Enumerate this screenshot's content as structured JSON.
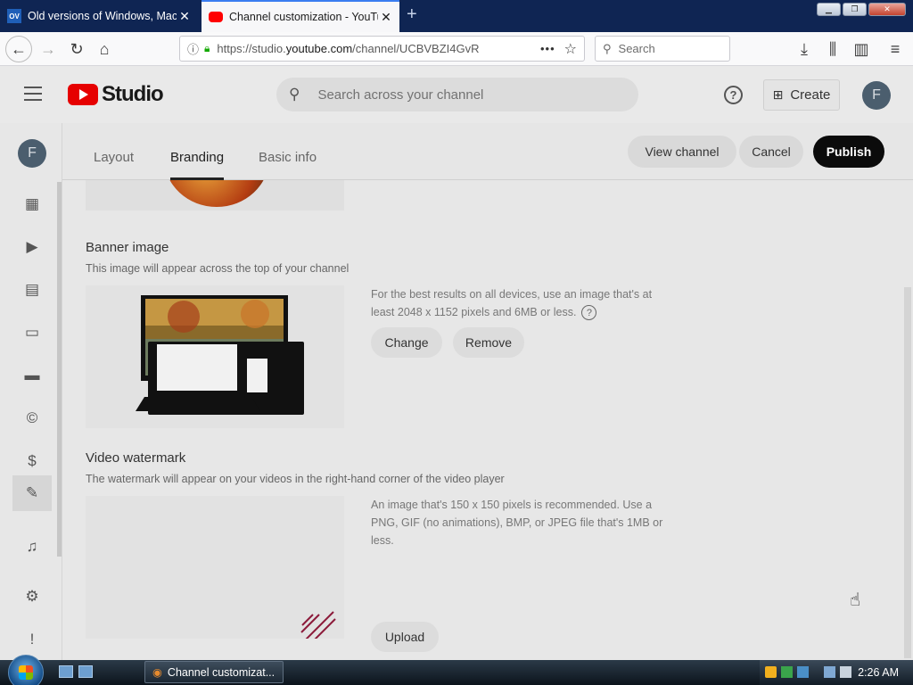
{
  "browser": {
    "tabs": [
      {
        "favicon": "OV",
        "title": "Old versions of Windows, Mac",
        "close": "✕"
      },
      {
        "title": "Channel customization - YouTube",
        "close": "✕"
      }
    ],
    "new_tab": "+",
    "url_prefix": "https://studio.",
    "url_domain": "youtube.com",
    "url_path": "/channel/UCBVBZI4GvR",
    "url_more": "•••",
    "search_placeholder": "Search"
  },
  "studio": {
    "wordmark": "Studio",
    "search_placeholder": "Search across your channel",
    "help": "?",
    "create_label": "Create",
    "avatar_letter": "F"
  },
  "sidebar": {
    "avatar_letter": "F",
    "icons": [
      "dashboard-icon",
      "content-icon",
      "analytics-icon",
      "comments-icon",
      "subtitles-icon",
      "copyright-icon",
      "monetization-icon",
      "customization-icon",
      "audio-library-icon",
      "settings-icon",
      "feedback-icon"
    ]
  },
  "customization": {
    "tabs": [
      "Layout",
      "Branding",
      "Basic info"
    ],
    "active_tab": "Branding",
    "view_channel": "View channel",
    "cancel": "Cancel",
    "publish": "Publish"
  },
  "banner": {
    "title": "Banner image",
    "desc": "This image will appear across the top of your channel",
    "info": "For the best results on all devices, use an image that's at least 2048 x 1152 pixels and 6MB or less.",
    "change": "Change",
    "remove": "Remove"
  },
  "watermark": {
    "title": "Video watermark",
    "desc": "The watermark will appear on your videos in the right-hand corner of the video player",
    "info": "An image that's 150 x 150 pixels is recommended. Use a PNG, GIF (no animations), BMP, or JPEG file that's 1MB or less.",
    "upload": "Upload"
  },
  "taskbar": {
    "task_label": "Channel customizat...",
    "clock": "2:26 AM"
  }
}
